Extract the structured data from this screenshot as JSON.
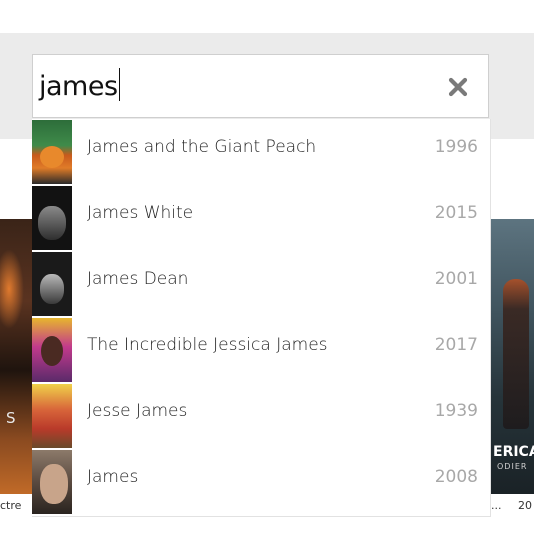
{
  "search": {
    "query": "james"
  },
  "results": [
    {
      "title": "James and the Giant Peach",
      "year": "1996"
    },
    {
      "title": "James White",
      "year": "2015"
    },
    {
      "title": "James Dean",
      "year": "2001"
    },
    {
      "title": "The Incredible Jessica James",
      "year": "2017"
    },
    {
      "title": "Jesse James",
      "year": "1939"
    },
    {
      "title": "James",
      "year": "2008"
    }
  ],
  "background": {
    "left_caption": "ctre",
    "right_caption_ellipsis": "...",
    "right_caption": "20",
    "left_poster_text": "S",
    "right_poster_text": "ERICA",
    "right_poster_subtext": "ODIER"
  },
  "icons": {
    "clear": "close-icon"
  },
  "colors": {
    "year": "#a8a8a8",
    "band": "#ebebeb",
    "title": "#222222"
  }
}
